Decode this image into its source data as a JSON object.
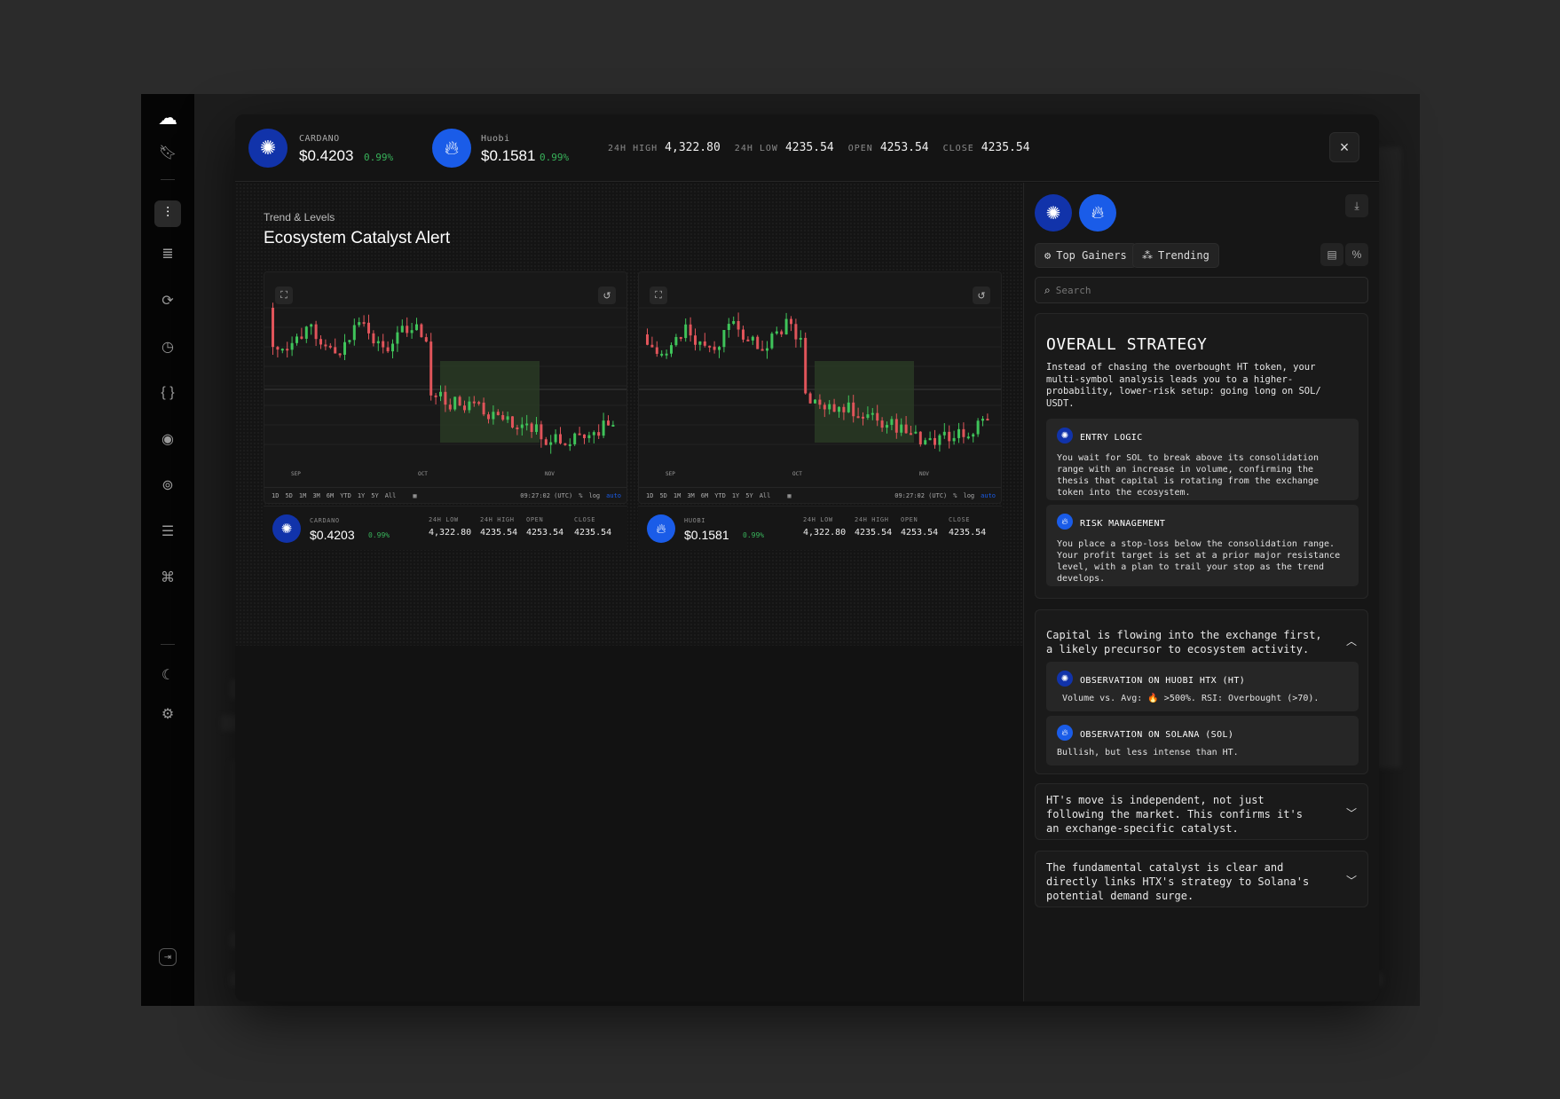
{
  "modal": {
    "header": {
      "coin1": {
        "name": "CARDANO",
        "price": "$0.4203",
        "change": "0.99%"
      },
      "coin2": {
        "name": "Huobi",
        "price": "$0.1581",
        "change": "0.99%"
      },
      "stats": [
        {
          "label": "24H HIGH",
          "value": "4,322.80"
        },
        {
          "label": "24H LOW",
          "value": "4235.54"
        },
        {
          "label": "OPEN",
          "value": "4253.54"
        },
        {
          "label": "CLOSE",
          "value": "4235.54"
        }
      ],
      "close_icon": "×"
    },
    "panel": {
      "subtitle": "Trend & Levels",
      "title": "Ecosystem Catalyst Alert"
    },
    "charts": [
      {
        "months": [
          "SEP",
          "OCT",
          "NOV"
        ],
        "timeframes": [
          "1D",
          "5D",
          "1M",
          "3M",
          "6M",
          "YTD",
          "1Y",
          "5Y",
          "All"
        ],
        "time": "09:27:02 (UTC)",
        "opts": [
          "%",
          "log",
          "auto"
        ],
        "ticker": {
          "name": "CARDANO",
          "price": "$0.4203",
          "change": "0.99%",
          "stats": [
            {
              "label": "24H LOW",
              "value": "4,322.80"
            },
            {
              "label": "24H HIGH",
              "value": "4235.54"
            },
            {
              "label": "OPEN",
              "value": "4253.54"
            },
            {
              "label": "CLOSE",
              "value": "4235.54"
            }
          ]
        }
      },
      {
        "months": [
          "SEP",
          "OCT",
          "NOV"
        ],
        "timeframes": [
          "1D",
          "5D",
          "1M",
          "3M",
          "6M",
          "YTD",
          "1Y",
          "5Y",
          "All"
        ],
        "time": "09:27:02 (UTC)",
        "opts": [
          "%",
          "log",
          "auto"
        ],
        "ticker": {
          "name": "HUOBI",
          "price": "$0.1581",
          "change": "0.99%",
          "stats": [
            {
              "label": "24H LOW",
              "value": "4,322.80"
            },
            {
              "label": "24H HIGH",
              "value": "4235.54"
            },
            {
              "label": "OPEN",
              "value": "4253.54"
            },
            {
              "label": "CLOSE",
              "value": "4235.54"
            }
          ]
        }
      }
    ],
    "sidepanel": {
      "tabs": [
        "Top Gainers",
        "Trending"
      ],
      "search_placeholder": "Search",
      "strategy": {
        "title": "OVERALL STRATEGY",
        "body": "Instead of chasing the overbought HT token, your multi-symbol analysis leads you to a higher-probability, lower-risk setup: going long on SOL/ USDT.",
        "entry": {
          "title": "ENTRY LOGIC",
          "body": "You wait for SOL to break above its consolidation range with an increase in volume, confirming the thesis that capital is rotating from the exchange token into the ecosystem."
        },
        "risk": {
          "title": "RISK MANAGEMENT",
          "body": "You place a stop-loss below the consolidation range. Your profit target is set at a prior major resistance level, with a plan to trail your stop as the trend develops."
        }
      },
      "accordions": [
        {
          "text": "Capital is flowing into the exchange first, a likely precursor to ecosystem activity.",
          "expanded": true,
          "items": [
            {
              "title": "OBSERVATION ON HUOBI HTX (HT)",
              "body": "Volume vs. Avg: 🔥 >500%. RSI: Overbought (>70)."
            },
            {
              "title": "OBSERVATION ON SOLANA (SOL)",
              "body": "Bullish, but less intense than HT."
            }
          ]
        },
        {
          "text": "HT's move is independent, not just following the market. This confirms it's an exchange-specific catalyst.",
          "expanded": false
        },
        {
          "text": "The fundamental catalyst is clear and directly links HTX's strategy to Solana's potential demand surge.",
          "expanded": false
        }
      ]
    }
  },
  "colors": {
    "up": "#3fc45a",
    "down": "#e0545a",
    "accent": "#1a5ce8",
    "ada": "#1133aa"
  }
}
